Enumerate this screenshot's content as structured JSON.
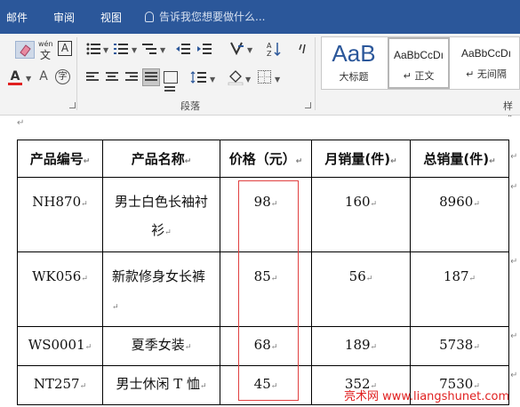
{
  "tabs": [
    "邮件",
    "审阅",
    "视图"
  ],
  "tell_me": "告诉我您想要做什么...",
  "ribbon": {
    "paragraph_group_label": "段落",
    "styles_group_label": "样式",
    "styles": [
      {
        "sample": "AaB",
        "name": "大标题"
      },
      {
        "sample": "AaBbCcDı",
        "name": "正文"
      },
      {
        "sample": "AaBbCcDı",
        "name": "无间隔"
      }
    ],
    "wen_label": "wén",
    "char_a": "A",
    "char_z": "字"
  },
  "table": {
    "headers": [
      "产品编号",
      "产品名称",
      "价格（元）",
      "月销量(件)",
      "总销量(件)"
    ],
    "rows": [
      {
        "code": "NH870",
        "name": "男士白色长袖衬衫",
        "price": "98",
        "monthly": "160",
        "total": "8960"
      },
      {
        "code": "WK056",
        "name": "新款修身女长裤",
        "price": "85",
        "monthly": "56",
        "total": "187"
      },
      {
        "code": "WS0001",
        "name": "夏季女装",
        "price": "68",
        "monthly": "189",
        "total": "5738"
      },
      {
        "code": "NT257",
        "name": "男士休闲 T 恤",
        "price": "45",
        "monthly": "352",
        "total": "7530"
      }
    ]
  },
  "watermark": "亮术网 www.liangshunet.com",
  "colors": {
    "tabbar": "#2b579a",
    "highlight_box": "#e04040",
    "font_color_bar": "#e02020"
  }
}
